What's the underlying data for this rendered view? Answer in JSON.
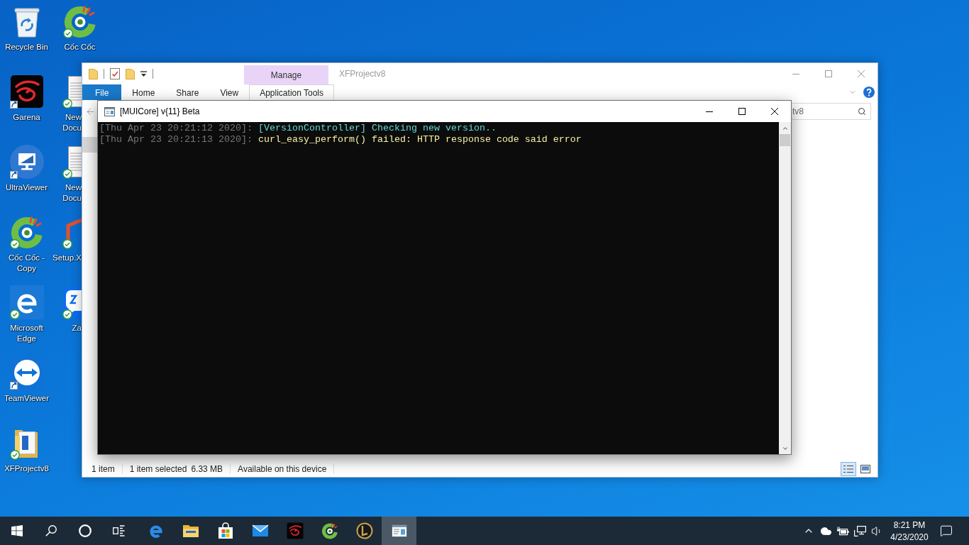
{
  "desktop": {
    "columns": [
      {
        "icons": [
          {
            "label": "Recycle Bin",
            "kind": "recycle",
            "synced": false,
            "shortcut": false
          },
          {
            "label": "Garena",
            "kind": "dragon",
            "synced": false,
            "shortcut": true
          },
          {
            "label": "UltraViewer",
            "kind": "monitor",
            "synced": false,
            "shortcut": true
          },
          {
            "label": "Cốc Cốc - Copy",
            "kind": "coccoc",
            "synced": true,
            "shortcut": false
          },
          {
            "label": "Microsoft Edge",
            "kind": "edge",
            "synced": true,
            "shortcut": false
          },
          {
            "label": "TeamViewer",
            "kind": "arrows",
            "synced": false,
            "shortcut": true
          },
          {
            "label": "XFProjectv8",
            "kind": "folder",
            "synced": true,
            "shortcut": false
          }
        ]
      },
      {
        "icons": [
          {
            "label": "Cốc Cốc",
            "kind": "coccoc",
            "synced": true,
            "shortcut": false
          },
          {
            "label": "New Docu",
            "kind": "document",
            "synced": true,
            "shortcut": false
          },
          {
            "label": "New Docu",
            "kind": "document",
            "synced": true,
            "shortcut": false
          },
          {
            "label": "Setup.X",
            "kind": "office",
            "synced": true,
            "shortcut": false
          },
          {
            "label": "Za",
            "kind": "chat",
            "synced": true,
            "shortcut": false
          }
        ]
      }
    ]
  },
  "explorer": {
    "contextual_group": "Manage",
    "title": "XFProjectv8",
    "ribbon_tabs": [
      {
        "label": "File",
        "kind": "menu",
        "selected": false
      },
      {
        "label": "Home",
        "kind": "tab",
        "selected": false
      },
      {
        "label": "Share",
        "kind": "tab",
        "selected": false
      },
      {
        "label": "View",
        "kind": "tab",
        "selected": false
      },
      {
        "label": "Application Tools",
        "kind": "tab",
        "selected": true
      }
    ],
    "search": {
      "placeholder": "tv8"
    },
    "nav_pane": {
      "items": [
        {
          "selected": true
        }
      ]
    },
    "status_bar": {
      "sections": [
        {
          "texts": [
            "1 item"
          ]
        },
        {
          "texts": [
            "1 item selected",
            "6.33 MB"
          ]
        },
        {
          "texts": [
            "Available on this device"
          ]
        }
      ]
    },
    "view_buttons": [
      {
        "kind": "details",
        "selected": true
      },
      {
        "kind": "thumbnails",
        "selected": false
      }
    ]
  },
  "console": {
    "title": "[MUICore] v{11} Beta",
    "lines": [
      {
        "timestamp": "[Thu Apr 23 20:21:12 2020]:",
        "message": "[VersionController] Checking new version..",
        "color": "#61d6d6"
      },
      {
        "timestamp": "[Thu Apr 23 20:21:13 2020]:",
        "message": "curl_easy_perform() failed: HTTP response code said error",
        "color": "#f9f1a5"
      }
    ]
  },
  "taskbar": {
    "apps": [
      {
        "kind": "edge",
        "selected": false
      },
      {
        "kind": "folder",
        "selected": false
      },
      {
        "kind": "store",
        "selected": false
      },
      {
        "kind": "mail",
        "selected": false
      },
      {
        "kind": "dragon",
        "selected": false
      },
      {
        "kind": "coccoc",
        "selected": false
      },
      {
        "kind": "emblem",
        "selected": false
      },
      {
        "kind": "console",
        "selected": true
      }
    ],
    "clock": {
      "time": "8:21 PM",
      "date": "4/23/2020"
    }
  }
}
